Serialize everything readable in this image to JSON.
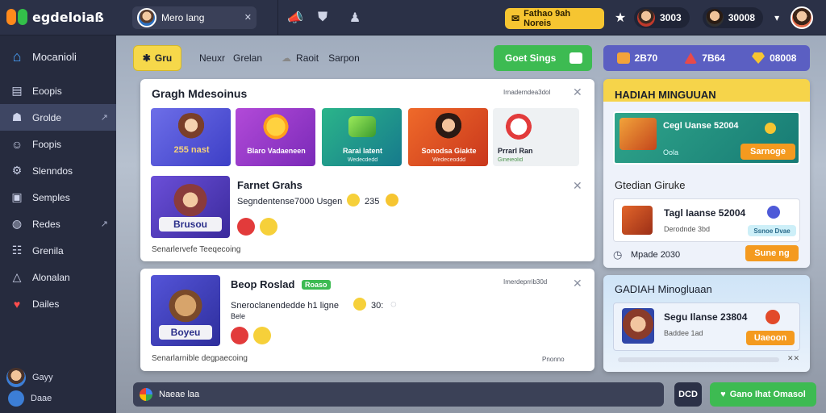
{
  "app": {
    "logo_text": "egdeloiaß"
  },
  "user": {
    "name": "Mero lang"
  },
  "notice": {
    "label": "Fathao 9ah Noreis"
  },
  "top_right": {
    "coins_a": "3003",
    "coins_b": "30008"
  },
  "sidebar": {
    "items": [
      {
        "label": "Mocanioli",
        "icon": "home-icon"
      },
      {
        "label": "Eoopis",
        "icon": "page-icon"
      },
      {
        "label": "Grolde",
        "icon": "group-icon",
        "arrow": "↗"
      },
      {
        "label": "Foopis",
        "icon": "person-icon"
      },
      {
        "label": "Slenndos",
        "icon": "gear-icon"
      },
      {
        "label": "Semples",
        "icon": "image-icon"
      },
      {
        "label": "Redes",
        "icon": "globe-icon",
        "arrow": "↗"
      },
      {
        "label": "Grenila",
        "icon": "users-icon"
      },
      {
        "label": "Alonalan",
        "icon": "alert-icon"
      },
      {
        "label": "Dailes",
        "icon": "heart-icon"
      }
    ],
    "profile": [
      {
        "label": "Gayy"
      },
      {
        "label": "Daae"
      }
    ]
  },
  "subhead": {
    "grid_label": "Gru",
    "link_1": "Neuxr",
    "link_2": "Grelan",
    "link_3": "Raoit",
    "link_4": "Sarpon",
    "get_button": "Goet Sings"
  },
  "stats": {
    "a": "2B70",
    "b": "7B64",
    "c": "08008"
  },
  "card1": {
    "title": "Gragh Mdesoinus",
    "meta": "Irnaderndea3dol",
    "tiles": [
      {
        "label": "255 nast",
        "sub": ""
      },
      {
        "label": "Blaro Vadaeneen",
        "sub": ""
      },
      {
        "label": "Rarai latent",
        "sub": "Wedecdedd"
      },
      {
        "label": "Sonodsa Giakte",
        "sub": "Wedeceoddd"
      },
      {
        "label": "Prrarl Ran",
        "sub": "Gineieolid"
      }
    ],
    "feature": {
      "badge": "Brusou",
      "title": "Farnet Grahs",
      "line": "Segndentense7000 Usgen",
      "count": "235"
    },
    "footer": "Senarlervefe Teeqecoing"
  },
  "card2": {
    "title": "Beop Roslad",
    "tag": "Roaso",
    "meta": "Imerdeprrib30d",
    "feature_badge": "Boyeu",
    "line1": "Sneroclanendedde h1 ligne",
    "line1b": "30:",
    "line2": "Bele",
    "footer": "Senarlarnible degpaecoing",
    "footer_right": "Pnonno"
  },
  "right": {
    "panel1_title": "HADIAH MINGUUAN",
    "promo": {
      "title": "Cegl Uanse 52004",
      "sub": "Oola",
      "button": "Sarnoge"
    },
    "panel2_title": "Gtedian Giruke",
    "item": {
      "title": "Tagl Iaanse 52004",
      "sub": "Derodnde 3bd",
      "button": "Ssnoe Dvae"
    },
    "footer": "Mpade 2030",
    "footer_btn": "Sune ng",
    "panel3_title": "GADIAH Minogluaan",
    "item2": {
      "title": "Segu Ilanse 23804",
      "sub": "Baddee 1ad",
      "button": "Uaeoon"
    }
  },
  "bottom": {
    "input_text": "Naeae laa",
    "icon_label": "DCD",
    "button": "Gano Ihat Omasol"
  },
  "colors": {
    "accent": "#f6c531",
    "green": "#3dbb52",
    "indigo": "#5b5fc2",
    "orange": "#f49a1f"
  }
}
